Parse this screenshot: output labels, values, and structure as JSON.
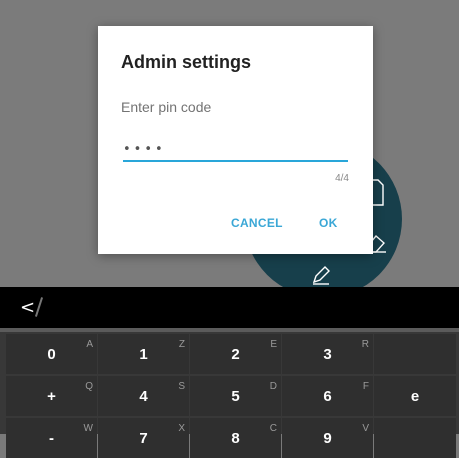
{
  "dialog": {
    "title": "Admin settings",
    "pin_label": "Enter pin code",
    "pin_value": "••••",
    "counter": "4/4",
    "cancel_label": "CANCEL",
    "ok_label": "OK"
  },
  "keyboard_bar": {
    "back_icon": "<"
  },
  "keyboard": {
    "rows": [
      [
        {
          "main": "0",
          "hint": "A"
        },
        {
          "main": "1",
          "hint": "Z"
        },
        {
          "main": "2",
          "hint": "E"
        },
        {
          "main": "3",
          "hint": "R"
        },
        {
          "main": "",
          "hint": ""
        }
      ],
      [
        {
          "main": "+",
          "hint": "Q"
        },
        {
          "main": "4",
          "hint": "S"
        },
        {
          "main": "5",
          "hint": "D"
        },
        {
          "main": "6",
          "hint": "F"
        },
        {
          "main": "e",
          "hint": ""
        }
      ],
      [
        {
          "main": "-",
          "hint": "W"
        },
        {
          "main": "7",
          "hint": "X"
        },
        {
          "main": "8",
          "hint": "C"
        },
        {
          "main": "9",
          "hint": "V"
        },
        {
          "main": "",
          "hint": ""
        }
      ]
    ]
  },
  "colors": {
    "accent": "#29a6d9",
    "circle": "#173f4b",
    "backdrop": "#7b7b7b"
  }
}
